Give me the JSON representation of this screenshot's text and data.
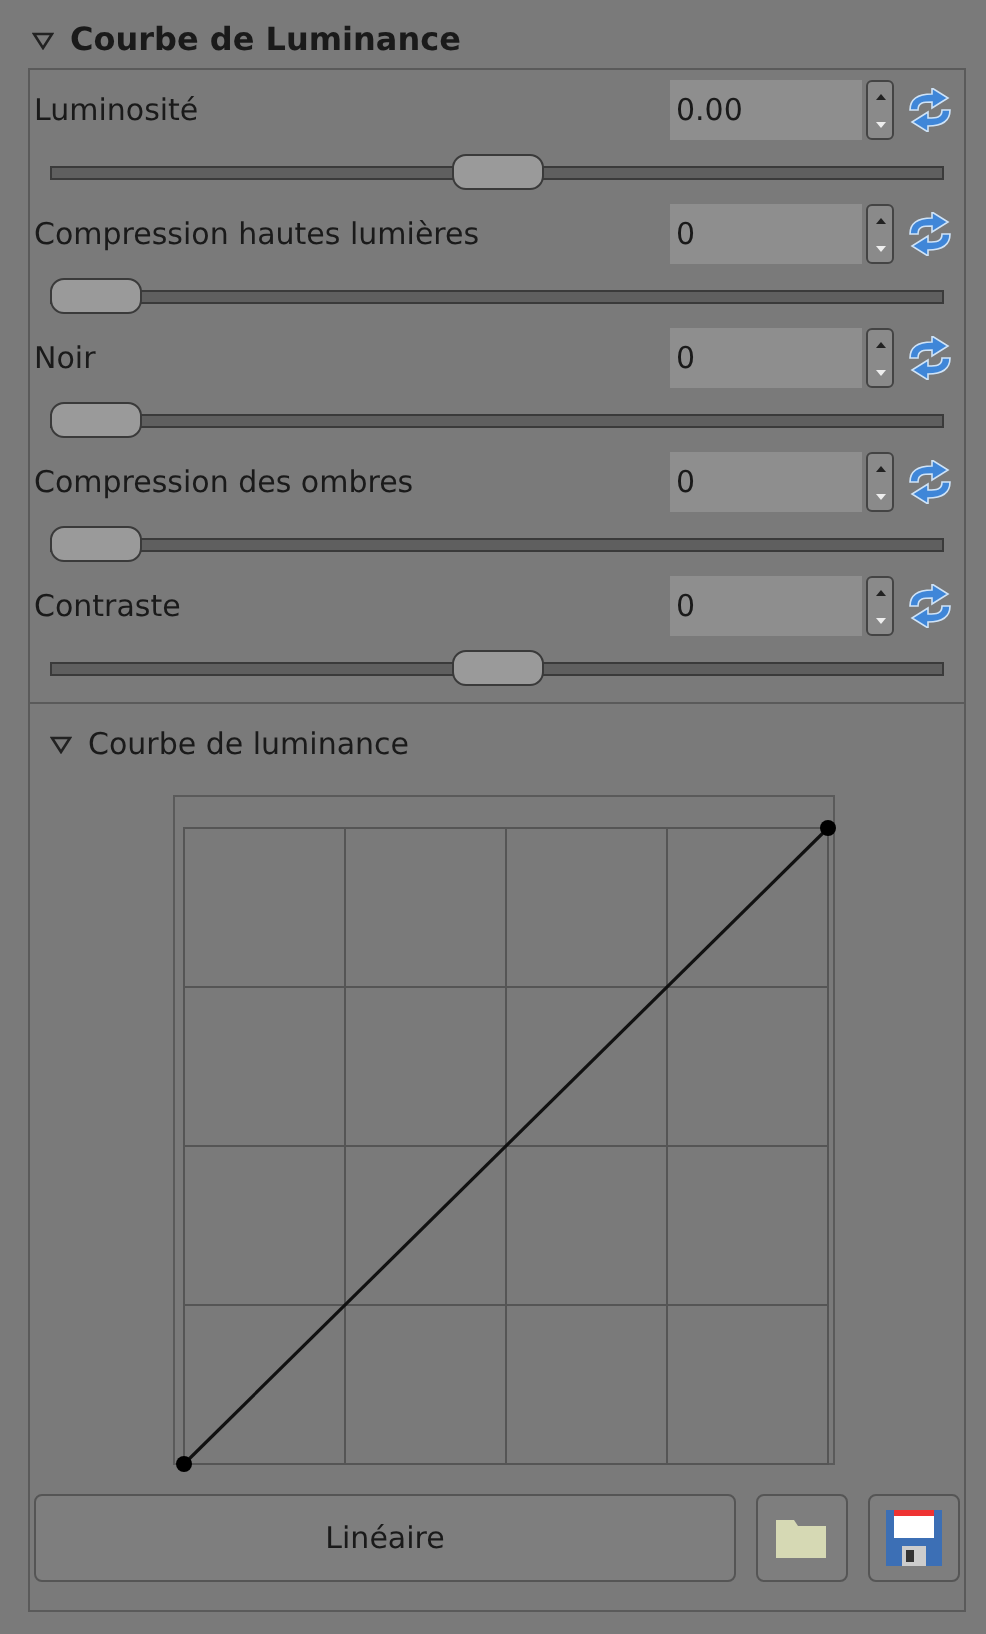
{
  "panel": {
    "title": "Courbe de Luminance",
    "expanded": true
  },
  "sliders": [
    {
      "label": "Luminosité",
      "value": "0.00",
      "level": 0.5
    },
    {
      "label": "Compression hautes lumières",
      "value": "0",
      "level": 0
    },
    {
      "label": "Noir",
      "value": "0",
      "level": 0
    },
    {
      "label": "Compression des ombres",
      "value": "0",
      "level": 0
    },
    {
      "label": "Contraste",
      "value": "0",
      "level": 0.5
    }
  ],
  "curve": {
    "title": "Courbe de luminance",
    "expanded": true
  },
  "buttons": [
    {
      "label": "Linéaire"
    }
  ]
}
